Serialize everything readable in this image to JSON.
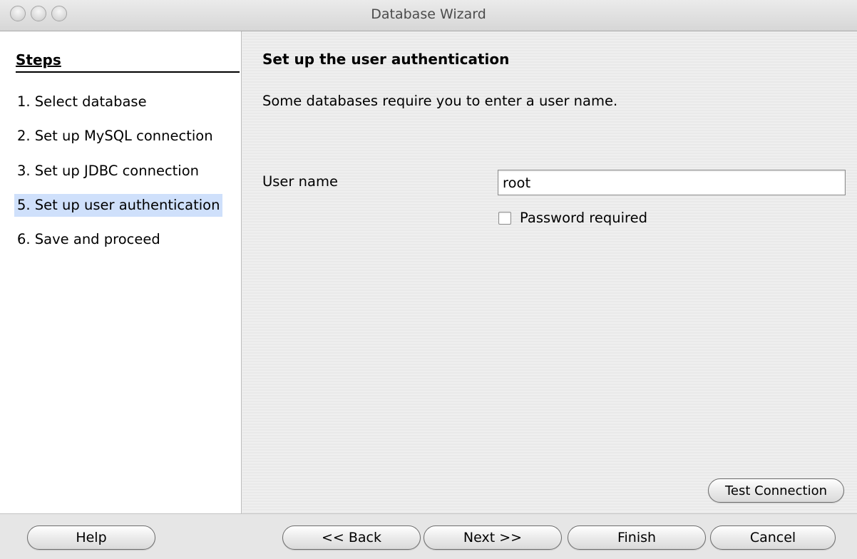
{
  "window": {
    "title": "Database Wizard"
  },
  "steps": {
    "header": "Steps",
    "items": [
      {
        "label": "1. Select database",
        "active": false
      },
      {
        "label": "2. Set up MySQL connection",
        "active": false
      },
      {
        "label": "3. Set up JDBC connection",
        "active": false
      },
      {
        "label": "5. Set up user authentication",
        "active": true
      },
      {
        "label": "6. Save and proceed",
        "active": false
      }
    ]
  },
  "content": {
    "title": "Set up the user authentication",
    "description": "Some databases require you to enter a user name.",
    "user_name_label": "User name",
    "user_name_value": "root",
    "password_required_label": "Password required",
    "password_required_checked": false,
    "test_connection_label": "Test Connection"
  },
  "footer": {
    "help_label": "Help",
    "back_label": "<< Back",
    "next_label": "Next >>",
    "finish_label": "Finish",
    "cancel_label": "Cancel"
  },
  "colors": {
    "active_step_highlight": "#cfe0fb",
    "steps_panel_bg": "#ffffff",
    "content_bg": "#ececec"
  }
}
